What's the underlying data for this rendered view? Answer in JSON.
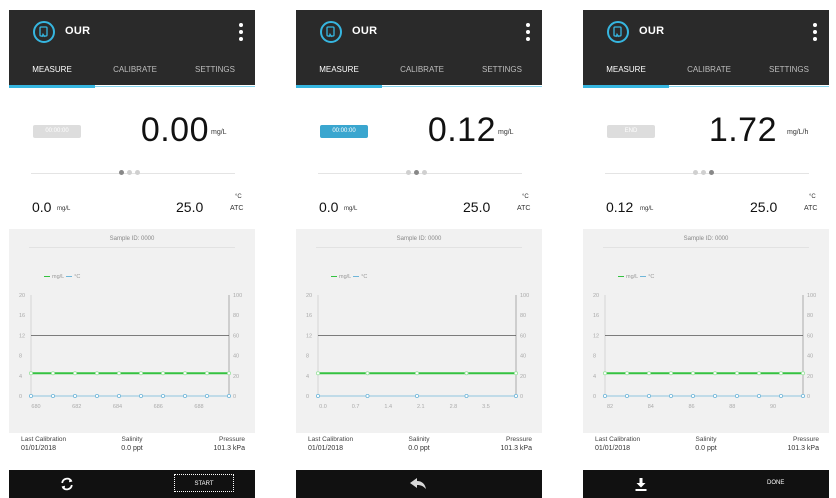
{
  "common": {
    "app_title": "OUR",
    "tabs": [
      "MEASURE",
      "CALIBRATE",
      "SETTINGS"
    ],
    "temp_value": "25.0",
    "temp_unit": "°C",
    "temp_mode": "ATC",
    "legend": {
      "series_a": "mg/L",
      "series_b": "°C"
    },
    "footer": {
      "last_calibration_label": "Last Calibration",
      "last_calibration_value": "01/01/2018",
      "salinity_label": "Salinity",
      "salinity_value": "0.0 ppt",
      "pressure_label": "Pressure",
      "pressure_value": "101.3 kPa"
    }
  },
  "screens": [
    {
      "timer": "00:00:00",
      "big_value": "0.00",
      "big_unit": "mg/L",
      "small_value": "0.0",
      "small_unit": "mg/L",
      "sample_id": "Sample ID: 0000",
      "active_dot": 0,
      "bottom_right_label": "START",
      "icons": {
        "left": "refresh-icon"
      }
    },
    {
      "timer": "00:00:00",
      "big_value": "0.12",
      "big_unit": "mg/L",
      "small_value": "0.0",
      "small_unit": "mg/L",
      "sample_id": "Sample ID: 0000",
      "active_dot": 1,
      "bottom_right_label": "",
      "icons": {
        "center": "back-arrow-icon"
      }
    },
    {
      "timer": "END",
      "big_value": "1.72",
      "big_unit": "mg/L/h",
      "small_value": "0.12",
      "small_unit": "mg/L",
      "sample_id": "Sample ID: 0000",
      "active_dot": 2,
      "bottom_right_label": "DONE",
      "icons": {
        "left": "download-icon"
      }
    }
  ],
  "chart_data": [
    {
      "type": "line",
      "y_left_ticks": [
        "20",
        "16",
        "12",
        "8",
        "4",
        "0"
      ],
      "y_right_ticks": [
        "100",
        "80",
        "60",
        "40",
        "20",
        "0"
      ],
      "x_tick_labels": [
        "680",
        "682",
        "684",
        "686",
        "688"
      ],
      "series": [
        {
          "name": "mg/L",
          "axis": "left",
          "color": "#34c240",
          "values": [
            4.5,
            4.5,
            4.5,
            4.5,
            4.5,
            4.5,
            4.5,
            4.5,
            4.5,
            4.5
          ]
        },
        {
          "name": "°C",
          "axis": "right",
          "color": "#6fb6d9",
          "values": [
            0,
            0,
            0,
            0,
            0,
            0,
            0,
            0,
            0,
            0
          ]
        }
      ],
      "reference_line": 12
    },
    {
      "type": "line",
      "y_left_ticks": [
        "20",
        "16",
        "12",
        "8",
        "4",
        "0"
      ],
      "y_right_ticks": [
        "100",
        "80",
        "60",
        "40",
        "20",
        "0"
      ],
      "x_tick_labels": [
        "0.0",
        "0.7",
        "1.4",
        "2.1",
        "2.8",
        "3.5"
      ],
      "series": [
        {
          "name": "mg/L",
          "axis": "left",
          "color": "#34c240",
          "values": [
            4.5,
            4.5,
            4.5,
            4.5,
            4.5
          ]
        },
        {
          "name": "°C",
          "axis": "right",
          "color": "#6fb6d9",
          "values": [
            0,
            0,
            0,
            0,
            0
          ]
        }
      ],
      "reference_line": 12
    },
    {
      "type": "line",
      "y_left_ticks": [
        "20",
        "16",
        "12",
        "8",
        "4",
        "0"
      ],
      "y_right_ticks": [
        "100",
        "80",
        "60",
        "40",
        "20",
        "0"
      ],
      "x_tick_labels": [
        "82",
        "84",
        "86",
        "88",
        "90"
      ],
      "series": [
        {
          "name": "mg/L",
          "axis": "left",
          "color": "#34c240",
          "values": [
            4.5,
            4.5,
            4.5,
            4.5,
            4.5,
            4.5,
            4.5,
            4.5,
            4.5,
            4.5
          ]
        },
        {
          "name": "°C",
          "axis": "right",
          "color": "#6fb6d9",
          "values": [
            0,
            0,
            0,
            0,
            0,
            0,
            0,
            0,
            0,
            0
          ]
        }
      ],
      "reference_line": 12
    }
  ]
}
